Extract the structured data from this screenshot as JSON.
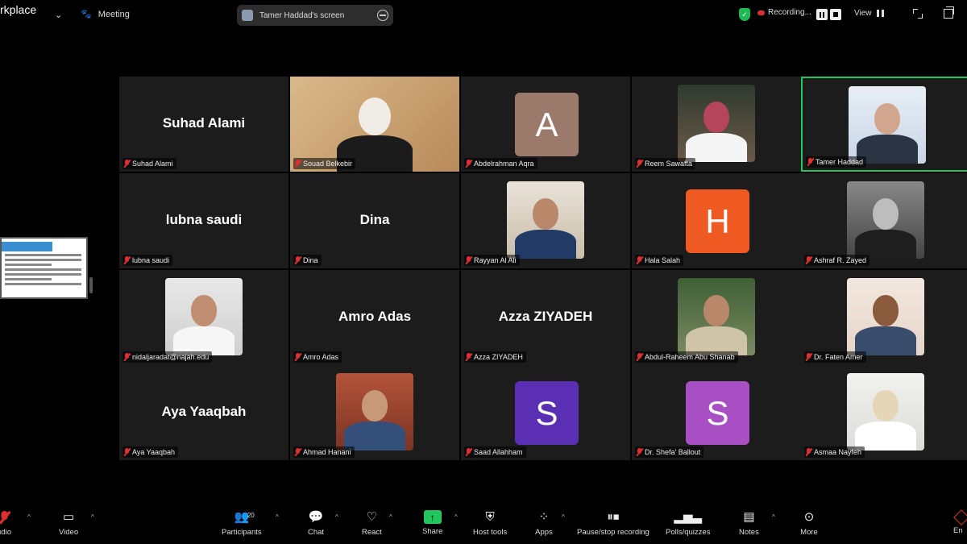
{
  "topbar": {
    "app_title_line1": "",
    "app_title_line2": "rkplace",
    "meeting_label": "Meeting",
    "screen_share_label": "Tamer Haddad's screen",
    "recording_label": "Recording...",
    "view_label": "View"
  },
  "tiles": [
    {
      "name": "Suhad Alami",
      "display": "name",
      "display_text": "Suhad Alami"
    },
    {
      "name": "Souad Belkebir",
      "display": "video"
    },
    {
      "name": "Abdelrahman Aqra",
      "display": "letter",
      "letter": "A",
      "color": "#9c7a6b"
    },
    {
      "name": "Reem Sawafta",
      "display": "photo"
    },
    {
      "name": "Tamer Haddad",
      "display": "photo",
      "active": true
    },
    {
      "name": "lubna saudi",
      "display": "name",
      "display_text": "lubna saudi"
    },
    {
      "name": "Dina",
      "display": "name",
      "display_text": "Dina"
    },
    {
      "name": "Rayyan Al Ali",
      "display": "photo"
    },
    {
      "name": "Hala Salah",
      "display": "letter",
      "letter": "H",
      "color": "#ef5a22"
    },
    {
      "name": "Ashraf R. Zayed",
      "display": "photo"
    },
    {
      "name": "nidaljaradat@najah.edu",
      "display": "photo"
    },
    {
      "name": "Amro Adas",
      "display": "name",
      "display_text": "Amro Adas"
    },
    {
      "name": "Azza ZIYADEH",
      "display": "name",
      "display_text": "Azza ZIYADEH"
    },
    {
      "name": "Abdul-Raheem Abu Shanab",
      "display": "photo"
    },
    {
      "name": "Dr. Faten Amer",
      "display": "photo"
    },
    {
      "name": "Aya Yaaqbah",
      "display": "name",
      "display_text": "Aya Yaaqbah"
    },
    {
      "name": "Ahmad Hanani",
      "display": "photo"
    },
    {
      "name": "Saad Allahham",
      "display": "letter",
      "letter": "S",
      "color": "#5b2fb3"
    },
    {
      "name": "Dr. Shefa' Ballout",
      "display": "letter",
      "letter": "S",
      "color": "#a84fc4"
    },
    {
      "name": "Asmaa Nayfeh",
      "display": "photo"
    }
  ],
  "toolbar": {
    "audio_label": "udio",
    "video_label": "Video",
    "participants_label": "Participants",
    "participants_count": "20",
    "chat_label": "Chat",
    "react_label": "React",
    "share_label": "Share",
    "host_tools_label": "Host tools",
    "apps_label": "Apps",
    "recording_label": "Pause/stop recording",
    "polls_label": "Polls/quizzes",
    "notes_label": "Notes",
    "more_label": "More",
    "end_label": "En"
  },
  "colors": {
    "active_speaker": "#22c55e",
    "muted": "#e02f2f",
    "tile_bg": "#1c1c1c"
  }
}
